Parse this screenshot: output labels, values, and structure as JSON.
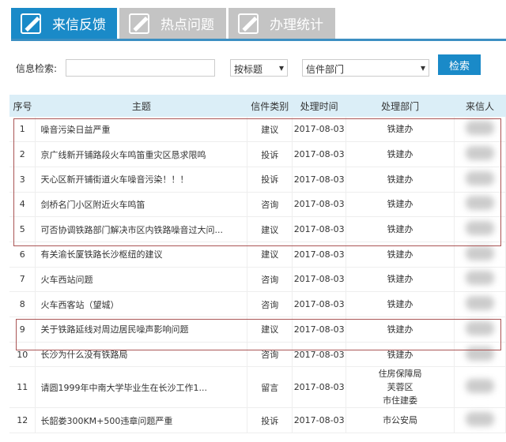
{
  "tabs": [
    {
      "label": "来信反馈",
      "active": true
    },
    {
      "label": "热点问题"
    },
    {
      "label": "办理统计"
    }
  ],
  "search": {
    "label": "信息检索:",
    "value": "",
    "mode": "按标题",
    "dept": "信件部门",
    "button": "检索"
  },
  "columns": [
    "序号",
    "主题",
    "信件类别",
    "处理时间",
    "处理部门",
    "来信人"
  ],
  "rows": [
    {
      "no": "1",
      "subject": "噪音污染日益严重",
      "type": "建议",
      "date": "2017-08-03",
      "dept": "铁建办"
    },
    {
      "no": "2",
      "subject": "京广线新开铺路段火车鸣笛重灾区恳求限鸣",
      "type": "投诉",
      "date": "2017-08-03",
      "dept": "铁建办"
    },
    {
      "no": "3",
      "subject": "天心区新开铺街道火车噪音污染！！！",
      "type": "投诉",
      "date": "2017-08-03",
      "dept": "铁建办"
    },
    {
      "no": "4",
      "subject": "剑桥名门小区附近火车鸣笛",
      "type": "咨询",
      "date": "2017-08-03",
      "dept": "铁建办"
    },
    {
      "no": "5",
      "subject": "可否协调铁路部门解决市区内铁路噪音过大问...",
      "type": "建议",
      "date": "2017-08-03",
      "dept": "铁建办"
    },
    {
      "no": "6",
      "subject": "有关渝长厦铁路长沙枢纽的建议",
      "type": "建议",
      "date": "2017-08-03",
      "dept": "铁建办"
    },
    {
      "no": "7",
      "subject": "火车西站问题",
      "type": "咨询",
      "date": "2017-08-03",
      "dept": "铁建办"
    },
    {
      "no": "8",
      "subject": "火车西客站（望城）",
      "type": "咨询",
      "date": "2017-08-03",
      "dept": "铁建办"
    },
    {
      "no": "9",
      "subject": "关于铁路延线对周边居民噪声影响问题",
      "type": "建议",
      "date": "2017-08-03",
      "dept": "铁建办"
    },
    {
      "no": "10",
      "subject": "长沙为什么没有铁路局",
      "type": "咨询",
      "date": "2017-08-03",
      "dept": "铁建办"
    },
    {
      "no": "11",
      "subject": "请圆1999年中南大学毕业生在长沙工作1...",
      "type": "留言",
      "date": "2017-08-03",
      "dept": "住房保障局\n芙蓉区\n市住建委"
    },
    {
      "no": "12",
      "subject": "长韶娄300KM+500违章问题严重",
      "type": "投诉",
      "date": "2017-08-03",
      "dept": "市公安局"
    }
  ]
}
